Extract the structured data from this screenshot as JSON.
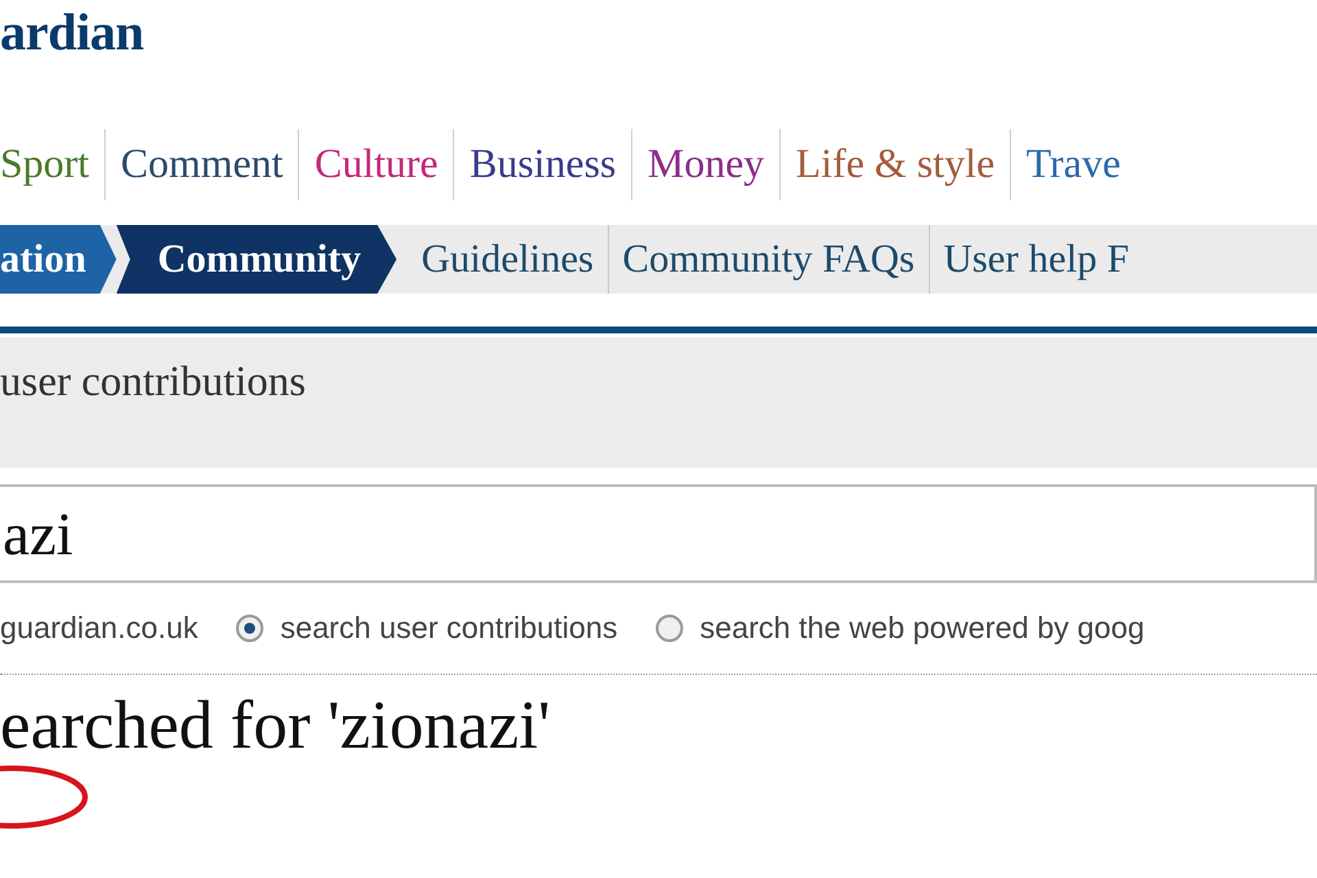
{
  "logo": {
    "text": "ardian"
  },
  "sections": [
    {
      "label": "Sport",
      "color": "#4b7a2b"
    },
    {
      "label": "Comment",
      "color": "#2c4a6b"
    },
    {
      "label": "Culture",
      "color": "#c4287c"
    },
    {
      "label": "Business",
      "color": "#3b3b8c"
    },
    {
      "label": "Money",
      "color": "#8c2d8c"
    },
    {
      "label": "Life & style",
      "color": "#a35c3c"
    },
    {
      "label": "Trave",
      "color": "#2b6aa8"
    }
  ],
  "subnav": [
    {
      "label": "ation",
      "kind": "crumb",
      "selected": false
    },
    {
      "label": "Community",
      "kind": "crumb",
      "selected": true
    },
    {
      "label": "Guidelines",
      "kind": "link"
    },
    {
      "label": "Community FAQs",
      "kind": "link"
    },
    {
      "label": "User help F",
      "kind": "link"
    }
  ],
  "panel": {
    "title": "user contributions"
  },
  "search": {
    "value": "azi"
  },
  "scope_options": [
    {
      "label": "guardian.co.uk",
      "kind": "text"
    },
    {
      "label": "search user contributions",
      "kind": "radio",
      "selected": true
    },
    {
      "label": "search the web powered by goog",
      "kind": "radio",
      "selected": false
    }
  ],
  "results": {
    "heading": "earched for 'zionazi'"
  }
}
